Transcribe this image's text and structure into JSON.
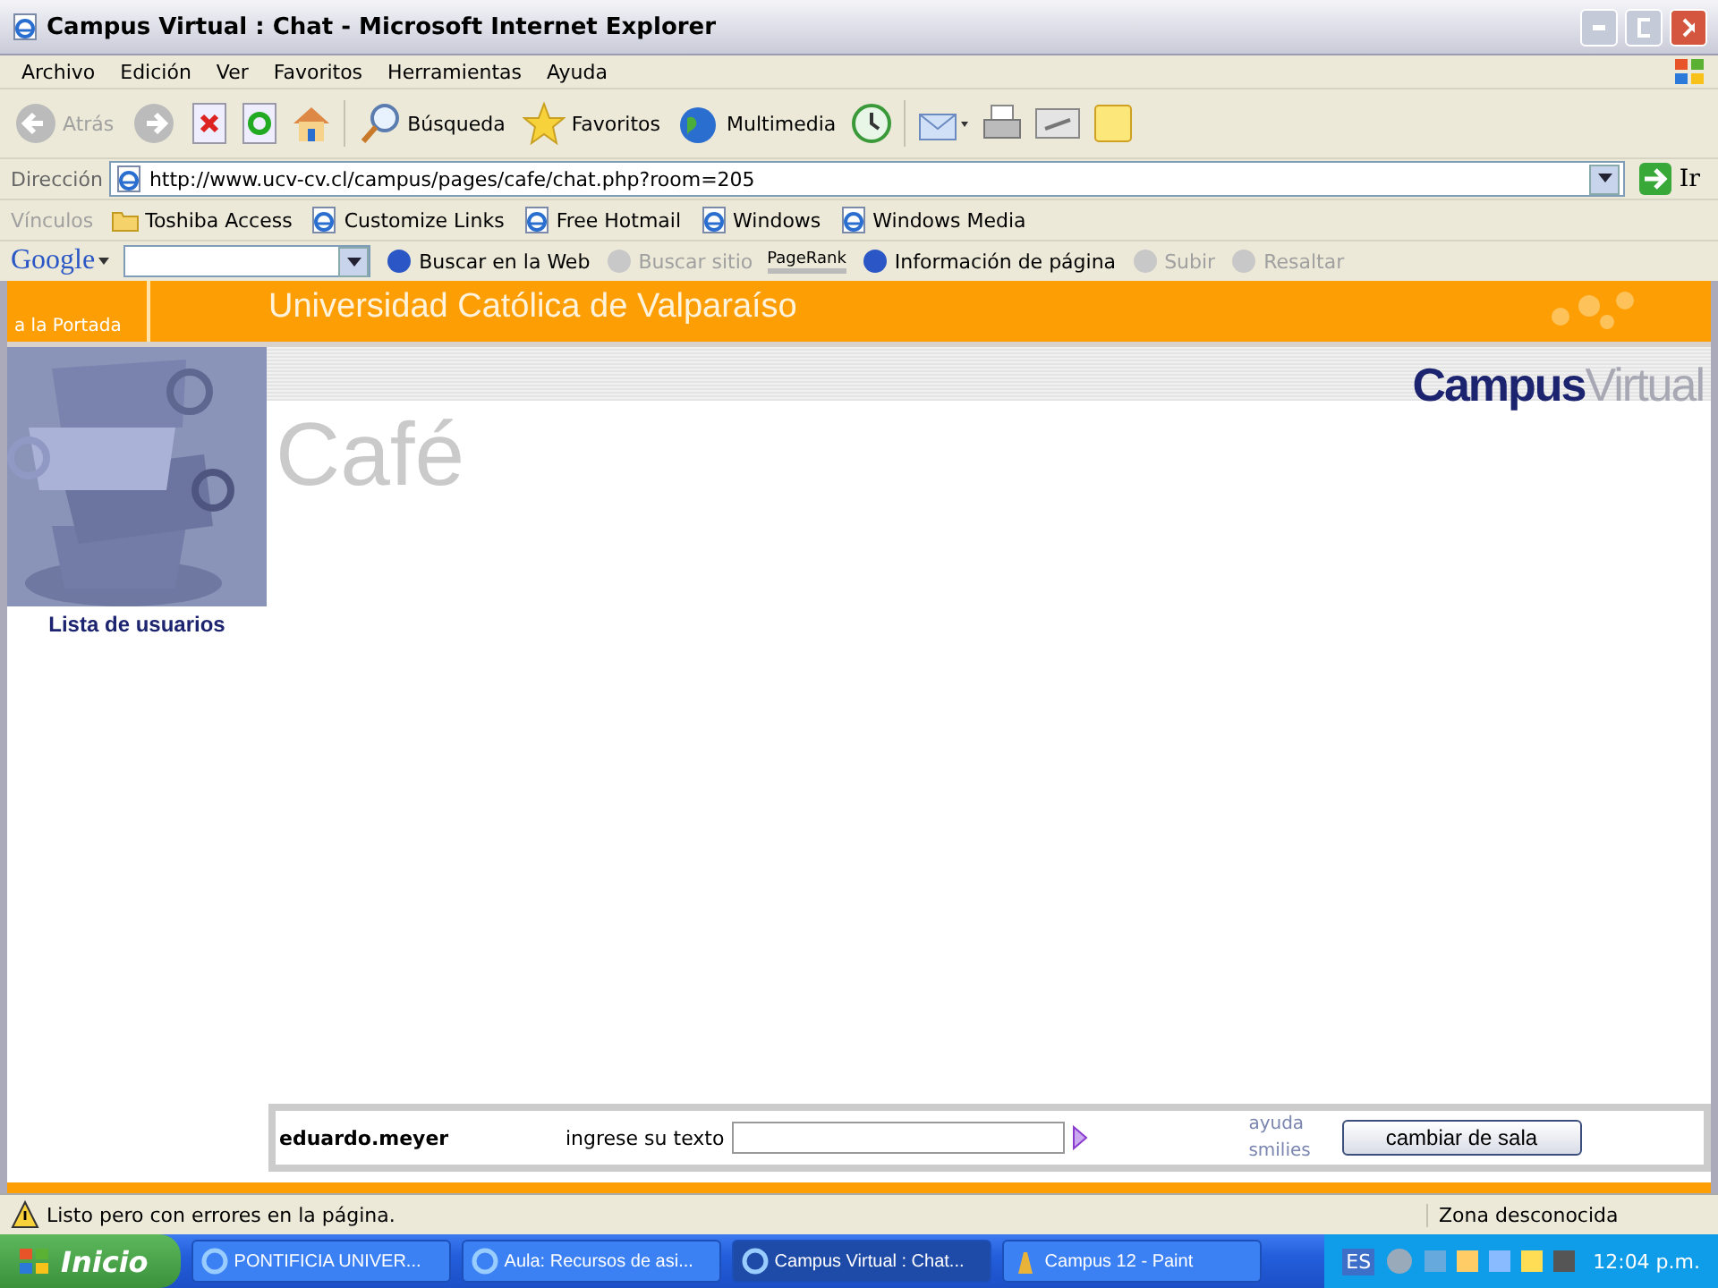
{
  "window": {
    "title": "Campus Virtual : Chat - Microsoft Internet Explorer"
  },
  "menu": [
    "Archivo",
    "Edición",
    "Ver",
    "Favoritos",
    "Herramientas",
    "Ayuda"
  ],
  "toolbar": {
    "back": "Atrás",
    "search": "Búsqueda",
    "favorites": "Favoritos",
    "media": "Multimedia"
  },
  "address": {
    "label": "Dirección",
    "url": "http://www.ucv-cv.cl/campus/pages/cafe/chat.php?room=205",
    "go": "Ir"
  },
  "links": {
    "label": "Vínculos",
    "items": [
      "Toshiba Access",
      "Customize Links",
      "Free Hotmail",
      "Windows",
      "Windows Media"
    ]
  },
  "google_bar": {
    "brand": "Google",
    "items": [
      {
        "label": "Buscar en la Web",
        "disabled": false
      },
      {
        "label": "Buscar sitio",
        "disabled": true
      },
      {
        "label": "PageRank",
        "disabled": false
      },
      {
        "label": "Información de página",
        "disabled": false
      },
      {
        "label": "Subir",
        "disabled": true
      },
      {
        "label": "Resaltar",
        "disabled": true
      }
    ]
  },
  "page": {
    "back_link": "a la Portada",
    "university": "Universidad Católica de Valparaíso",
    "logo_strong": "Campus",
    "logo_light": "Virtual",
    "section_title": "Café",
    "users_link": "Lista de usuarios",
    "chat": {
      "username": "eduardo.meyer",
      "prompt": "ingrese su texto",
      "links": [
        "ayuda",
        "smilies"
      ],
      "button": "cambiar de sala"
    }
  },
  "status_bar": {
    "text": "Listo pero con errores en la página.",
    "zone": "Zona desconocida"
  },
  "taskbar": {
    "start": "Inicio",
    "tasks": [
      {
        "label": "PONTIFICIA UNIVER...",
        "selected": false
      },
      {
        "label": "Aula: Recursos de asi...",
        "selected": false
      },
      {
        "label": "Campus Virtual : Chat...",
        "selected": true
      },
      {
        "label": "Campus 12 - Paint",
        "selected": false
      }
    ],
    "language": "ES",
    "clock": "12:04 p.m."
  }
}
